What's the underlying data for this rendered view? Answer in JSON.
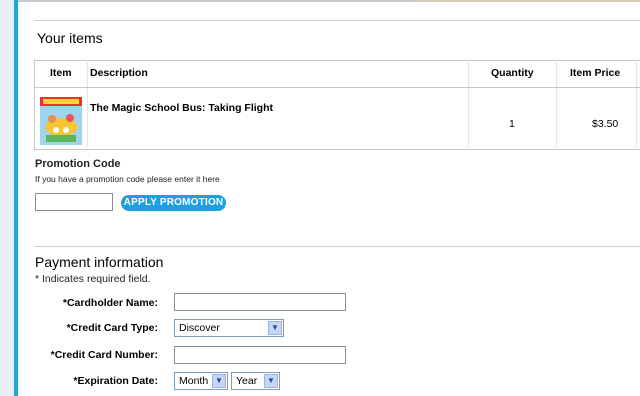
{
  "items_section": {
    "title": "Your items",
    "columns": [
      "Item",
      "Description",
      "Quantity",
      "Item Price"
    ],
    "rows": [
      {
        "description": "The Magic School Bus: Taking Flight",
        "quantity": "1",
        "item_price": "$3.50",
        "thumbnail": "book-cover-image"
      }
    ]
  },
  "promotion": {
    "title": "Promotion Code",
    "hint": "If you have a promotion code please enter it here",
    "input_value": "",
    "button_label": "APPLY PROMOTION"
  },
  "payment": {
    "title": "Payment information",
    "required_note": "* Indicates required field.",
    "fields": {
      "cardholder_name": {
        "label": "*Cardholder Name:",
        "value": ""
      },
      "card_type": {
        "label": "*Credit Card Type:",
        "value": "Discover"
      },
      "card_number": {
        "label": "*Credit Card Number:",
        "value": ""
      },
      "expiration": {
        "label": "*Expiration Date:",
        "month_value": "Month",
        "year_value": "Year"
      }
    }
  },
  "colors": {
    "accent_blue": "#1e9fe0",
    "left_bar_blue": "#1ea7dc",
    "border_gray": "#c7c7c7"
  }
}
